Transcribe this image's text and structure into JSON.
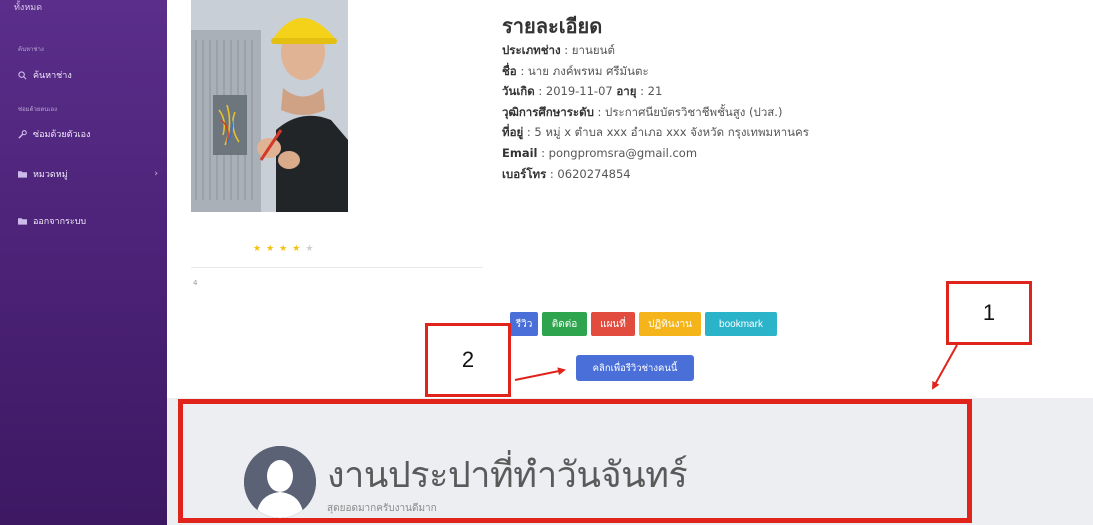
{
  "sidebar": {
    "top_label": "ทั้งหมด",
    "section_search": "ค้นหาช่าง",
    "search_item": "ค้นหาช่าง",
    "section_self": "ซ่อมด้วยตนเอง",
    "self_item": "ซ่อมด้วยตัวเอง",
    "category_item": "หมวดหมู่",
    "logout_item": "ออกจากระบบ"
  },
  "details": {
    "title": "รายละเอียด",
    "rows": [
      {
        "label": "ประเภทช่าง",
        "value": " : ยานยนต์"
      },
      {
        "label": "ชื่อ",
        "value": " : นาย ภงค์พรหม ศรีมันตะ"
      },
      {
        "label": "วันเกิด",
        "value": " : 2019-11-07 ",
        "label2": "อายุ",
        "value2": " : 21"
      },
      {
        "label": "วุฒิการศึกษาระดับ",
        "value": " : ประกาศนียบัตรวิชาชีพชั้นสูง (ปวส.)"
      },
      {
        "label": "ที่อยู่",
        "value": " : 5 หมู่ x ตำบล xxx อำเภอ xxx จังหวัด กรุงเทพมหานคร"
      },
      {
        "label": "Email",
        "value": " : pongpromsra@gmail.com"
      },
      {
        "label": "เบอร์โทร",
        "value": " : 0620274854"
      }
    ]
  },
  "rating": {
    "value": 4,
    "max": 5,
    "label": "4"
  },
  "buttons": {
    "review": "รีวิว",
    "contact": "ติดต่อ",
    "map": "แผนที่",
    "calendar": "ปฏิทินงาน",
    "bookmark": "bookmark",
    "review_cta": "คลิกเพื่อรีวิวช่างคนนี้"
  },
  "annotations": {
    "one": "1",
    "two": "2"
  },
  "review": {
    "title": "งานประปาที่ทำวันจันทร์",
    "subtitle": "สุดยอดมากครับงานดีมาก"
  },
  "colors": {
    "sidebar": "#4a2175",
    "annotation_red": "#e0231b",
    "btn_blue": "#4a6fd8",
    "btn_green": "#2ea44f",
    "btn_red": "#e24c3f",
    "btn_yellow": "#f4b41a",
    "btn_teal": "#2bb3c9"
  }
}
